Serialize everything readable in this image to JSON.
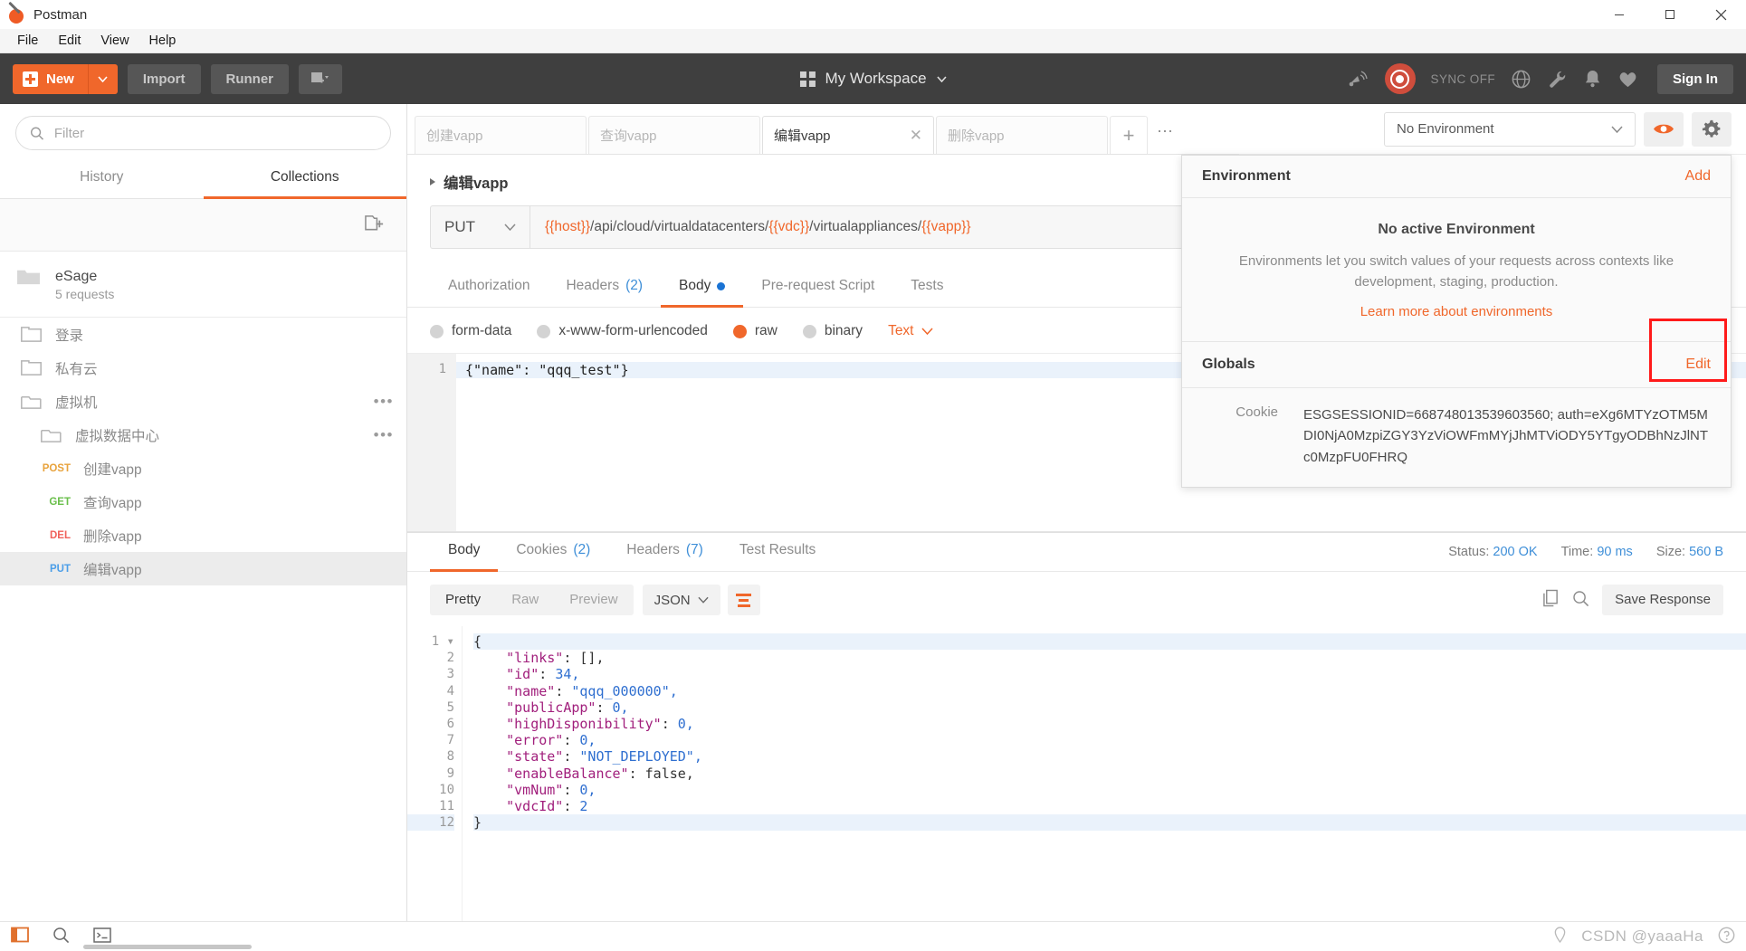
{
  "window": {
    "title": "Postman",
    "controls": {
      "minimize": "—",
      "maximize": "☐",
      "close": "✕"
    }
  },
  "menubar": {
    "items": [
      "File",
      "Edit",
      "View",
      "Help"
    ]
  },
  "toolbar": {
    "new_label": "New",
    "import_label": "Import",
    "runner_label": "Runner",
    "workspace_label": "My Workspace",
    "sync_label": "SYNC OFF",
    "signin_label": "Sign In",
    "icons": [
      "antenna-icon",
      "sync-orb-icon",
      "globe-icon",
      "wrench-icon",
      "bell-icon",
      "heart-icon"
    ]
  },
  "sidebar": {
    "filter_placeholder": "Filter",
    "filter_value": "",
    "tabs": [
      {
        "label": "History",
        "active": false
      },
      {
        "label": "Collections",
        "active": true
      }
    ],
    "collection": {
      "name": "eSage",
      "meta": "5 requests"
    },
    "tree": [
      {
        "label": "登录",
        "type": "folder",
        "indent": 0,
        "open": false,
        "method": "",
        "selected": false,
        "more": false
      },
      {
        "label": "私有云",
        "type": "folder",
        "indent": 0,
        "open": false,
        "method": "",
        "selected": false,
        "more": false
      },
      {
        "label": "虚拟机",
        "type": "folder",
        "indent": 0,
        "open": true,
        "method": "",
        "selected": false,
        "more": true
      },
      {
        "label": "虚拟数据中心",
        "type": "folder",
        "indent": 1,
        "open": true,
        "method": "",
        "selected": false,
        "more": true
      },
      {
        "label": "创建vapp",
        "type": "request",
        "indent": 2,
        "open": false,
        "method": "POST",
        "selected": false,
        "more": false
      },
      {
        "label": "查询vapp",
        "type": "request",
        "indent": 2,
        "open": false,
        "method": "GET",
        "selected": false,
        "more": false
      },
      {
        "label": "删除vapp",
        "type": "request",
        "indent": 2,
        "open": false,
        "method": "DEL",
        "selected": false,
        "more": false
      },
      {
        "label": "编辑vapp",
        "type": "request",
        "indent": 2,
        "open": false,
        "method": "PUT",
        "selected": true,
        "more": false
      }
    ]
  },
  "env_bar": {
    "selected": "No Environment",
    "eye_icon": "eye-icon",
    "gear_icon": "gear-icon"
  },
  "env_panel": {
    "header": "Environment",
    "add_label": "Add",
    "empty_title": "No active Environment",
    "empty_desc": "Environments let you switch values of your requests across contexts like development, staging, production.",
    "learn_more": "Learn more about environments",
    "globals_label": "Globals",
    "edit_label": "Edit",
    "cookie_key": "Cookie",
    "cookie_value": "ESGSESSIONID=668748013539603560; auth=eXg6MTYzOTM5MDI0NjA0MzpiZGY3YzViOWFmMYjJhMTViODY5YTgyODBhNzJlNTc0MzpFU0FHRQ",
    "highlight_color": "#ff1a1a"
  },
  "request_tabs": [
    {
      "label": "创建vapp",
      "active": false,
      "closable": false
    },
    {
      "label": "查询vapp",
      "active": false,
      "closable": false
    },
    {
      "label": "编辑vapp",
      "active": true,
      "closable": true
    },
    {
      "label": "删除vapp",
      "active": false,
      "closable": false
    }
  ],
  "request": {
    "name": "编辑vapp",
    "method": "PUT",
    "url_parts": [
      {
        "text": "{{host}}",
        "var": true
      },
      {
        "text": "/api/cloud/virtualdatacenters/",
        "var": false
      },
      {
        "text": "{{vdc}}",
        "var": true
      },
      {
        "text": "/virtualappliances/",
        "var": false
      },
      {
        "text": "{{vapp}}",
        "var": true
      }
    ],
    "url_plain": "{{host}}/api/cloud/virtualdatacenters/{{vdc}}/virtualappliances/{{vapp}}",
    "tabs": [
      {
        "label": "Authorization",
        "count": "",
        "active": false,
        "dot": false
      },
      {
        "label": "Headers",
        "count": "(2)",
        "active": false,
        "dot": false
      },
      {
        "label": "Body",
        "count": "",
        "active": true,
        "dot": true
      },
      {
        "label": "Pre-request Script",
        "count": "",
        "active": false,
        "dot": false
      },
      {
        "label": "Tests",
        "count": "",
        "active": false,
        "dot": false
      }
    ],
    "body_modes": [
      {
        "label": "form-data",
        "selected": false
      },
      {
        "label": "x-www-form-urlencoded",
        "selected": false
      },
      {
        "label": "raw",
        "selected": true
      },
      {
        "label": "binary",
        "selected": false
      }
    ],
    "body_format": "Text",
    "body_lines": [
      "{\"name\": \"qqq_test\"}"
    ]
  },
  "response": {
    "tabs": [
      {
        "label": "Body",
        "count": "",
        "active": true
      },
      {
        "label": "Cookies",
        "count": "(2)",
        "active": false
      },
      {
        "label": "Headers",
        "count": "(7)",
        "active": false
      },
      {
        "label": "Test Results",
        "count": "",
        "active": false
      }
    ],
    "status_label": "Status:",
    "status_value": "200 OK",
    "time_label": "Time:",
    "time_value": "90 ms",
    "size_label": "Size:",
    "size_value": "560 B",
    "view_modes": [
      {
        "label": "Pretty",
        "active": true
      },
      {
        "label": "Raw",
        "active": false
      },
      {
        "label": "Preview",
        "active": false
      }
    ],
    "format": "JSON",
    "wrap_icon": "word-wrap-icon",
    "copy_icon": "copy-icon",
    "search_icon": "search-icon",
    "save_label": "Save Response",
    "json_lines": [
      {
        "n": 1,
        "indent": 0,
        "text": "{",
        "kind": "brace",
        "fold": true
      },
      {
        "n": 2,
        "indent": 1,
        "key": "\"links\"",
        "value": "[],",
        "kind": "arr"
      },
      {
        "n": 3,
        "indent": 1,
        "key": "\"id\"",
        "value": "34,",
        "kind": "num"
      },
      {
        "n": 4,
        "indent": 1,
        "key": "\"name\"",
        "value": "\"qqq_000000\",",
        "kind": "str"
      },
      {
        "n": 5,
        "indent": 1,
        "key": "\"publicApp\"",
        "value": "0,",
        "kind": "num"
      },
      {
        "n": 6,
        "indent": 1,
        "key": "\"highDisponibility\"",
        "value": "0,",
        "kind": "num"
      },
      {
        "n": 7,
        "indent": 1,
        "key": "\"error\"",
        "value": "0,",
        "kind": "num"
      },
      {
        "n": 8,
        "indent": 1,
        "key": "\"state\"",
        "value": "\"NOT_DEPLOYED\",",
        "kind": "str"
      },
      {
        "n": 9,
        "indent": 1,
        "key": "\"enableBalance\"",
        "value": "false,",
        "kind": "bool"
      },
      {
        "n": 10,
        "indent": 1,
        "key": "\"vmNum\"",
        "value": "0,",
        "kind": "num"
      },
      {
        "n": 11,
        "indent": 1,
        "key": "\"vdcId\"",
        "value": "2",
        "kind": "num"
      },
      {
        "n": 12,
        "indent": 0,
        "text": "}",
        "kind": "brace",
        "fold": false
      }
    ]
  },
  "statusbar": {
    "icons": [
      "sidebar-toggle-icon",
      "search-icon",
      "console-icon",
      "location-icon",
      "help-icon"
    ],
    "watermark": "CSDN @yaaaHa"
  },
  "colors": {
    "accent": "#f0672b",
    "toolbar_bg": "#3f3f3f",
    "link_blue": "#3f8fd8",
    "method_post": "#e8a33d",
    "method_get": "#6abf4b",
    "method_del": "#f0615b",
    "method_put": "#4b9ee8",
    "highlight_red": "#ff1a1a"
  }
}
